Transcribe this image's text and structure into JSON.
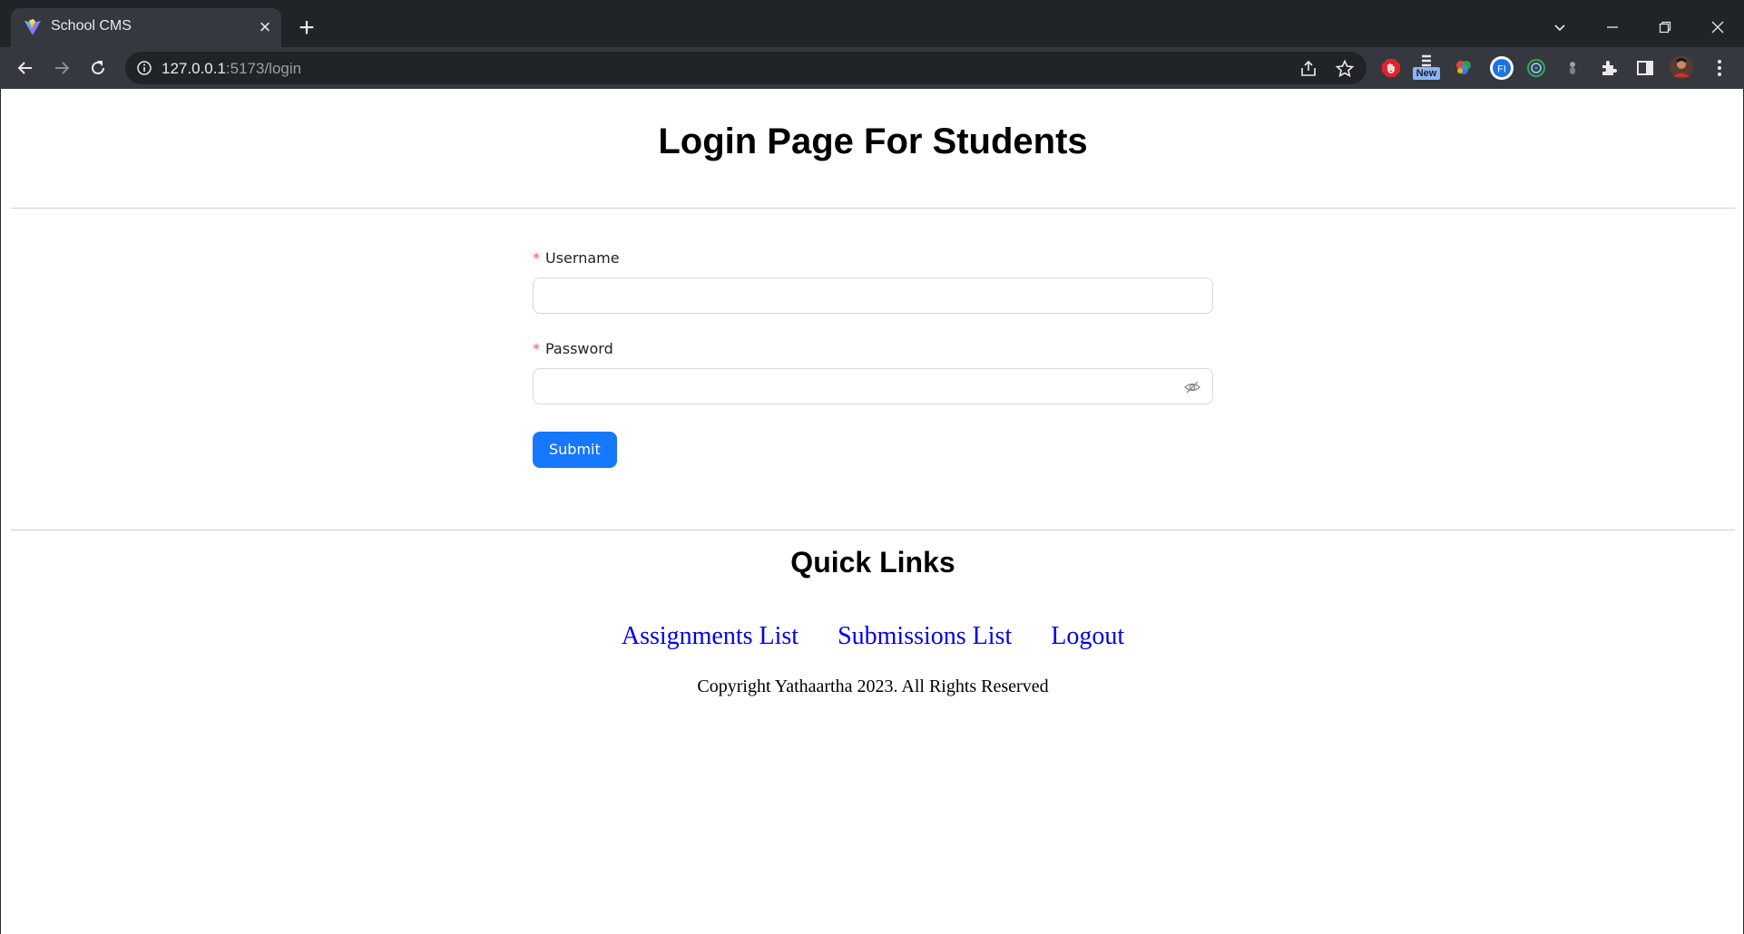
{
  "browser": {
    "tab_title": "School CMS",
    "url_host": "127.0.0.1",
    "url_rest": ":5173/login",
    "extension_badge": "New",
    "icons": [
      "vite-favicon",
      "close-icon",
      "new-tab-icon",
      "tab-search-icon",
      "minimize-icon",
      "restore-icon",
      "window-close-icon",
      "back-icon",
      "forward-icon",
      "reload-icon",
      "site-info-icon",
      "share-icon",
      "bookmark-star-icon",
      "extensions-icon",
      "side-panel-icon",
      "profile-avatar",
      "menu-icon"
    ]
  },
  "page": {
    "title": "Login Page For Students"
  },
  "form": {
    "username_label": "Username",
    "username_value": "",
    "password_label": "Password",
    "password_value": "",
    "required_mark": "*",
    "submit_label": "Submit",
    "colors": {
      "primary": "#1677ff",
      "required": "#ff4d4f"
    }
  },
  "footer": {
    "quick_links_title": "Quick Links",
    "links": [
      {
        "label": "Assignments List"
      },
      {
        "label": "Submissions List"
      },
      {
        "label": "Logout"
      }
    ],
    "copyright": "Copyright Yathaartha 2023. All Rights Reserved"
  }
}
